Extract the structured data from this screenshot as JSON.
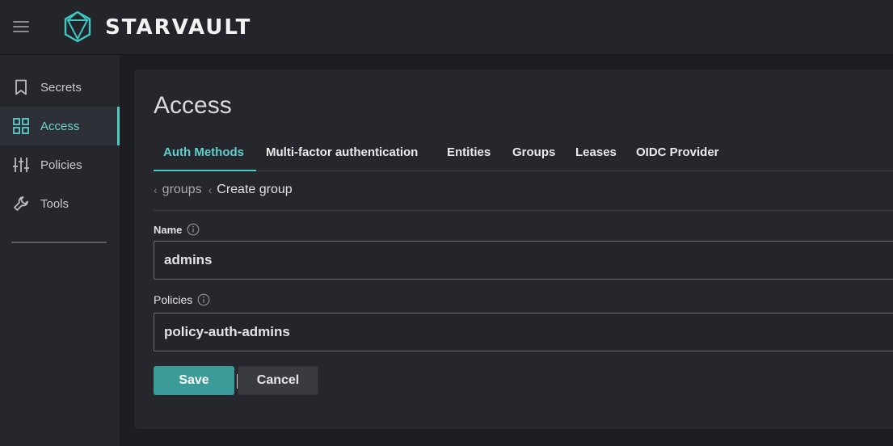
{
  "app": {
    "brand": "STARVAULT"
  },
  "sidebar": {
    "items": [
      {
        "label": "Secrets",
        "icon": "bookmark-icon",
        "active": false
      },
      {
        "label": "Access",
        "icon": "grid-icon",
        "active": true
      },
      {
        "label": "Policies",
        "icon": "sliders-icon",
        "active": false
      },
      {
        "label": "Tools",
        "icon": "wrench-icon",
        "active": false
      }
    ]
  },
  "main": {
    "title": "Access",
    "tabs": [
      {
        "label": "Auth Methods",
        "active": true
      },
      {
        "label": "Multi-factor authentication",
        "active": false
      },
      {
        "label": "Entities",
        "active": false
      },
      {
        "label": "Groups",
        "active": false
      },
      {
        "label": "Leases",
        "active": false
      },
      {
        "label": "OIDC Provider",
        "active": false
      }
    ],
    "breadcrumb": {
      "parent": "groups",
      "current": "Create group"
    },
    "form": {
      "name_label": "Name",
      "name_value": "admins",
      "policies_label": "Policies",
      "policies_value": "policy-auth-admins",
      "save_label": "Save",
      "cancel_label": "Cancel"
    }
  },
  "colors": {
    "accent": "#4ecbc5",
    "save_button": "#3a9b98",
    "background": "#1d1e22"
  }
}
